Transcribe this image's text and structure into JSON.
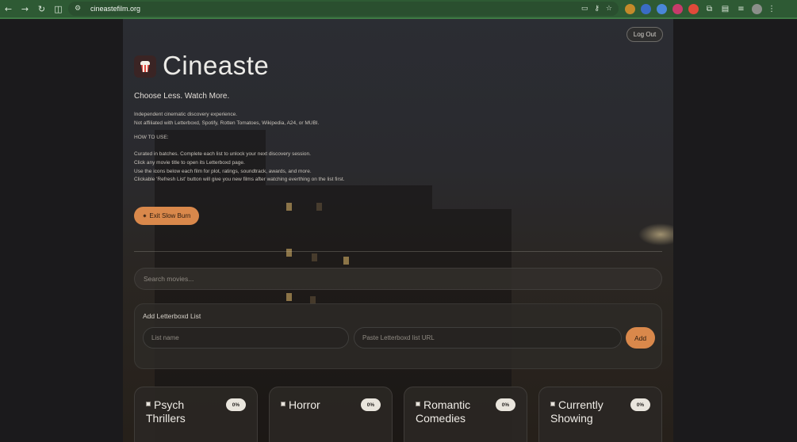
{
  "browser": {
    "url": "cineastefilm.org"
  },
  "header": {
    "logout_label": "Log Out",
    "site_title": "Cineaste",
    "tagline": "Choose Less. Watch More."
  },
  "info": {
    "line1": "Independent cinematic discovery experience.",
    "line2": "Not affiliated with Letterboxd, Spotify, Rotten Tomatoes, Wikipedia, A24, or MUBI.",
    "how_to_heading": "HOW TO USE:",
    "steps": [
      "Curated in batches. Complete each list to unlock your next discovery session.",
      "Click any movie title to open its Letterboxd page.",
      "Use the icons below each film for plot, ratings, soundtrack, awards, and more.",
      "Clickable 'Refresh List' button will give you new films after watching everthing on the list first."
    ]
  },
  "slow_burn": {
    "icon": "✷",
    "label": "Exit Slow Burn"
  },
  "search": {
    "placeholder": "Search movies..."
  },
  "add_list": {
    "title": "Add Letterboxd List",
    "name_placeholder": "List name",
    "url_placeholder": "Paste Letterboxd list URL",
    "add_label": "Add"
  },
  "lists": [
    {
      "title": "Psych Thrillers",
      "progress_label": "0%"
    },
    {
      "title": "Horror",
      "progress_label": "0%"
    },
    {
      "title": "Romantic Comedies",
      "progress_label": "0%"
    },
    {
      "title": "Currently Showing",
      "progress_label": "0%"
    }
  ],
  "colors": {
    "accent": "#d9884b",
    "chrome": "#2e5a34"
  }
}
